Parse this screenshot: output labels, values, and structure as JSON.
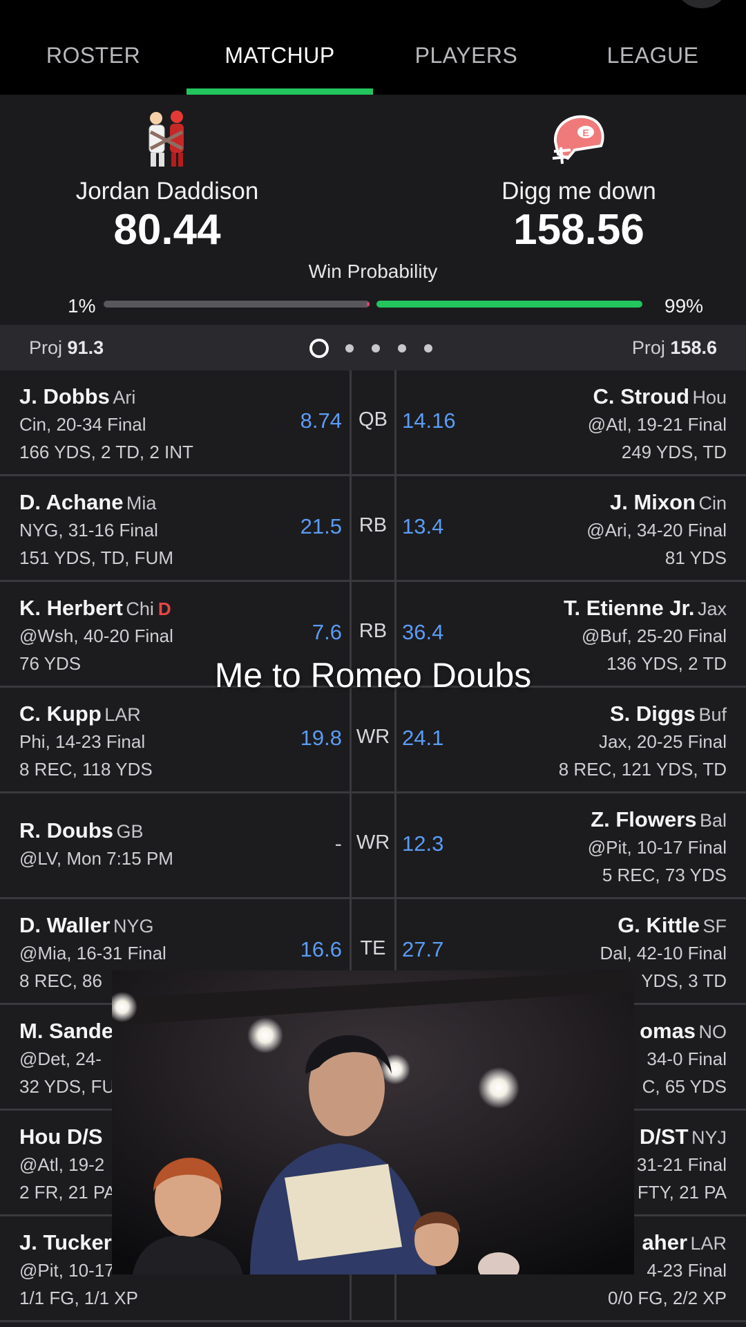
{
  "nav": {
    "tabs": [
      "ROSTER",
      "MATCHUP",
      "PLAYERS",
      "LEAGUE"
    ],
    "active": "MATCHUP"
  },
  "teams": {
    "home": {
      "name": "Jordan Daddison",
      "score": "80.44",
      "proj_label": "Proj",
      "proj": "91.3",
      "win_pct": "1%",
      "avatar_icon": "player-illustration-icon"
    },
    "away": {
      "name": "Digg me down",
      "score": "158.56",
      "proj_label": "Proj",
      "proj": "158.6",
      "win_pct": "99%",
      "avatar_icon": "football-helmet-icon"
    }
  },
  "win_probability_label": "Win Probability",
  "win_probability": {
    "home": 0.01,
    "away": 0.99
  },
  "pager": {
    "pages": 5,
    "active": 0
  },
  "colors": {
    "accent_green": "#22c55e",
    "score_blue": "#5b9cf5",
    "injury_red": "#ef4444"
  },
  "rows": [
    {
      "pos": "QB",
      "left": {
        "name": "J. Dobbs",
        "team": "Ari",
        "game": "Cin, 20-34 Final",
        "stats": "166 YDS, 2 TD, 2 INT",
        "score": "8.74"
      },
      "right": {
        "name": "C. Stroud",
        "team": "Hou",
        "game": "@Atl, 19-21 Final",
        "stats": "249 YDS, TD",
        "score": "14.16"
      }
    },
    {
      "pos": "RB",
      "left": {
        "name": "D. Achane",
        "team": "Mia",
        "game": "NYG, 31-16 Final",
        "stats": "151 YDS, TD, FUM",
        "score": "21.5"
      },
      "right": {
        "name": "J. Mixon",
        "team": "Cin",
        "game": "@Ari, 34-20 Final",
        "stats": "81 YDS",
        "score": "13.4"
      }
    },
    {
      "pos": "RB",
      "left": {
        "name": "K. Herbert",
        "team": "Chi",
        "injury": "D",
        "game": "@Wsh, 40-20 Final",
        "stats": "76 YDS",
        "score": "7.6"
      },
      "right": {
        "name": "T. Etienne Jr.",
        "team": "Jax",
        "game": "@Buf, 25-20 Final",
        "stats": "136 YDS, 2 TD",
        "score": "36.4"
      }
    },
    {
      "pos": "WR",
      "left": {
        "name": "C. Kupp",
        "team": "LAR",
        "game": "Phi, 14-23 Final",
        "stats": "8 REC, 118 YDS",
        "score": "19.8"
      },
      "right": {
        "name": "S. Diggs",
        "team": "Buf",
        "game": "Jax, 20-25 Final",
        "stats": "8 REC, 121 YDS, TD",
        "score": "24.1"
      }
    },
    {
      "pos": "WR",
      "left": {
        "name": "R. Doubs",
        "team": "GB",
        "game": "@LV, Mon 7:15 PM",
        "stats": "",
        "score": "-"
      },
      "right": {
        "name": "Z. Flowers",
        "team": "Bal",
        "game": "@Pit, 10-17 Final",
        "stats": "5 REC, 73 YDS",
        "score": "12.3"
      }
    },
    {
      "pos": "TE",
      "left": {
        "name": "D. Waller",
        "team": "NYG",
        "game": "@Mia, 16-31 Final",
        "stats": "8 REC, 86",
        "score": "16.6"
      },
      "right": {
        "name": "G. Kittle",
        "team": "SF",
        "game": "Dal, 42-10 Final",
        "stats": "YDS, 3 TD",
        "score": "27.7"
      }
    },
    {
      "pos": "",
      "left": {
        "name": "M. Sande",
        "team": "",
        "game": "@Det, 24-",
        "stats": "32 YDS, FU",
        "score": ""
      },
      "right": {
        "name": "omas",
        "team": "NO",
        "game": "34-0 Final",
        "stats": "C, 65 YDS",
        "score": ""
      }
    },
    {
      "pos": "",
      "left": {
        "name": "Hou D/S",
        "team": "",
        "game": "@Atl, 19-2",
        "stats": "2 FR, 21 PA",
        "score": ""
      },
      "right": {
        "name": "D/ST",
        "team": "NYJ",
        "game": "31-21 Final",
        "stats": "FTY, 21 PA",
        "score": ""
      }
    },
    {
      "pos": "",
      "left": {
        "name": "J. Tucker",
        "team": "",
        "game": "@Pit, 10-17",
        "stats": "1/1 FG, 1/1 XP",
        "score": ""
      },
      "right": {
        "name": "aher",
        "team": "LAR",
        "game": "4-23 Final",
        "stats": "0/0 FG, 2/2 XP",
        "score": ""
      }
    }
  ],
  "caption": "Me to Romeo Doubs",
  "video_overlay_icon": "video-still-icon"
}
